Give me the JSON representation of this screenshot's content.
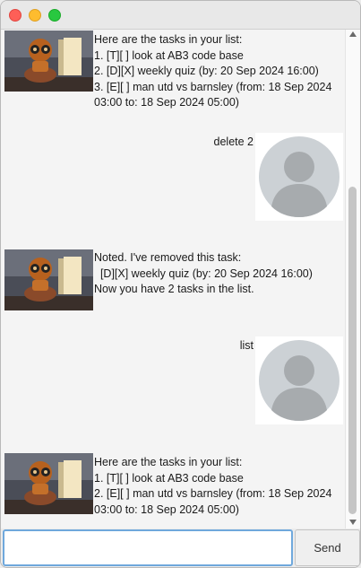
{
  "messages": [
    {
      "type": "bot",
      "lines": [
        "Here are the tasks in your list:",
        "1. [T][ ] look at AB3 code base",
        "2. [D][X] weekly quiz (by: 20 Sep 2024 16:00)",
        "3. [E][ ] man utd vs barnsley (from: 18 Sep 2024",
        "03:00 to: 18 Sep 2024 05:00)"
      ]
    },
    {
      "type": "user",
      "text": "delete 2"
    },
    {
      "type": "bot",
      "lines": [
        "Noted. I've removed this task:",
        "  [D][X] weekly quiz (by: 20 Sep 2024 16:00)",
        "Now you have 2 tasks in the list."
      ]
    },
    {
      "type": "user",
      "text": "list"
    },
    {
      "type": "bot",
      "lines": [
        "Here are the tasks in your list:",
        "1. [T][ ] look at AB3 code base",
        "2. [E][ ] man utd vs barnsley (from: 18 Sep 2024",
        "03:00 to: 18 Sep 2024 05:00)"
      ]
    }
  ],
  "input": {
    "value": "",
    "placeholder": ""
  },
  "send_label": "Send",
  "colors": {
    "close": "#fe5f57",
    "minimize": "#febc2e",
    "zoom": "#28c840",
    "input_focus": "#6fa8dc"
  }
}
